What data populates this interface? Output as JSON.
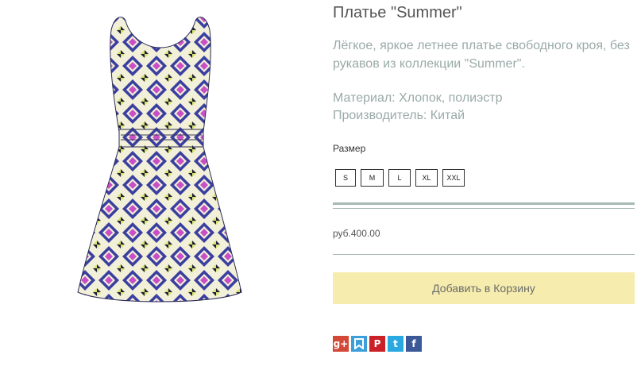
{
  "product": {
    "title": "Платье \"Summer\"",
    "description": "Лёгкое, яркое летнее платье свободного кроя, без рукавов из коллекции \"Summer\".",
    "material": "Материал: Хлопок, полиэстр",
    "manufacturer": "Производитель: Китай",
    "size_label": "Размер",
    "sizes": [
      "S",
      "M",
      "L",
      "XL",
      "XXL"
    ],
    "price": "руб.400.00",
    "add_to_cart": "Добавить в Корзину"
  },
  "share": [
    {
      "icon": "google-plus-icon",
      "glyph": "g+",
      "color": "#d34836"
    },
    {
      "icon": "bookmark-icon",
      "glyph": "",
      "color": "#3c9fd9"
    },
    {
      "icon": "pinterest-icon",
      "glyph": "P",
      "color": "#cb2027"
    },
    {
      "icon": "twitter-icon",
      "glyph": "t",
      "color": "#2aa9e0"
    },
    {
      "icon": "facebook-icon",
      "glyph": "f",
      "color": "#3b5998"
    }
  ]
}
